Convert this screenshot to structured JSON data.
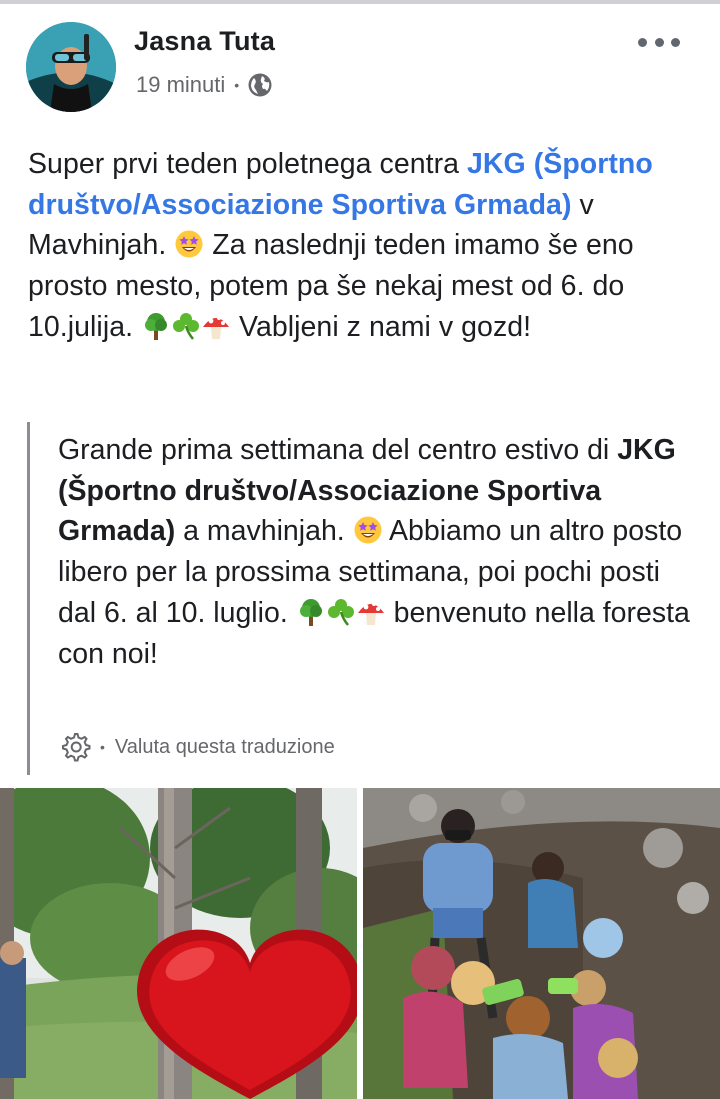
{
  "post": {
    "author_name": "Jasna Tuta",
    "timestamp": "19 minuti",
    "meta_separator": "•",
    "privacy_icon": "globe-icon",
    "more_icon": "more-horizontal-icon",
    "body": {
      "seg1": "Super prvi teden poletnega centra ",
      "link": "JKG (Športno društvo/Associazione Sportiva Grmada)",
      "seg2": " v Mavhinjah. ",
      "seg3": " Za naslednji teden imamo še eno prosto mesto, potem pa še nekaj mest od 6. do 10.julija. ",
      "seg4": " Vabljeni z nami v gozd!"
    },
    "translation": {
      "seg1": "Grande prima settimana del centro estivo di ",
      "bold": "JKG (Športno društvo/Associazione Sportiva Grmada)",
      "seg2": " a mavhinjah. ",
      "seg3": " Abbiamo un altro posto libero per la prossima settimana, poi pochi posti dal 6. al 10. luglio. ",
      "seg4": " benvenuto nella foresta con noi!",
      "gear_icon": "gear-icon",
      "separator": "•",
      "rate_label": "Valuta questa traduzione"
    },
    "emojis": [
      "star-struck-emoji",
      "tree-emoji",
      "shamrock-emoji",
      "mushroom-emoji"
    ]
  },
  "colors": {
    "link": "#3578e5",
    "text": "#1c1e21",
    "secondary": "#65676b",
    "quote_bar": "#8a8d91",
    "heart": "#d8141c"
  }
}
